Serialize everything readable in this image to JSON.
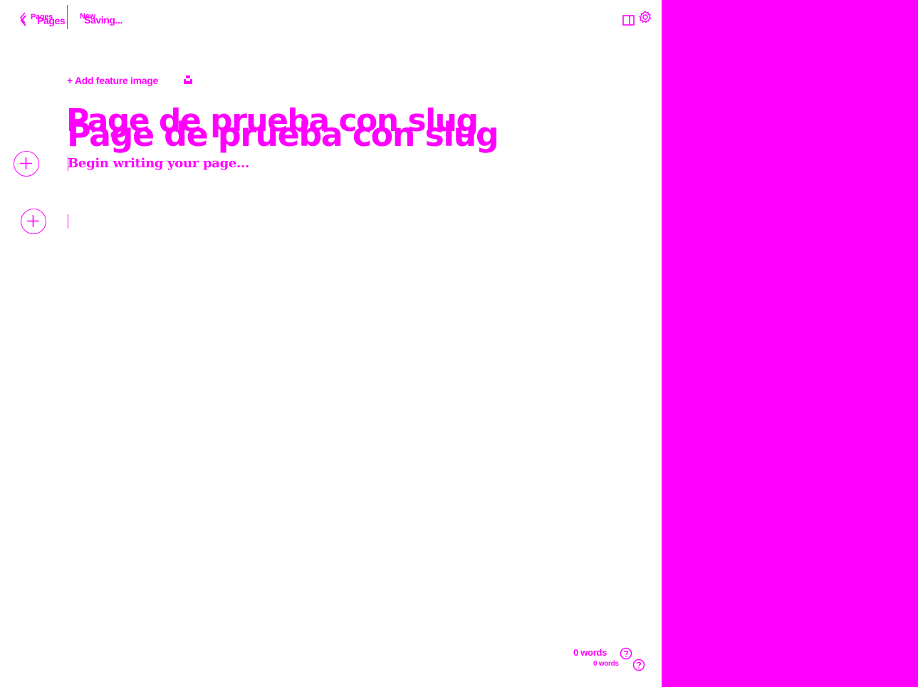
{
  "header": {
    "back_label": "Pages",
    "status_small": "New",
    "status_big": "Saving..."
  },
  "editor": {
    "feature_image_label": "+ Add feature image",
    "title": "Page de prueba con slug",
    "body_placeholder": "Begin writing your page..."
  },
  "footer": {
    "word_count": "0 words"
  },
  "colors": {
    "accent": "#ff00ff",
    "background": "#ffffff"
  },
  "icons": {
    "back": "chevron-left-icon",
    "sidebar_toggle": "sidebar-panel-icon",
    "settings": "gear-icon",
    "add_card": "plus-circle-icon",
    "help": "question-circle-icon",
    "unsplash": "unsplash-icon"
  }
}
